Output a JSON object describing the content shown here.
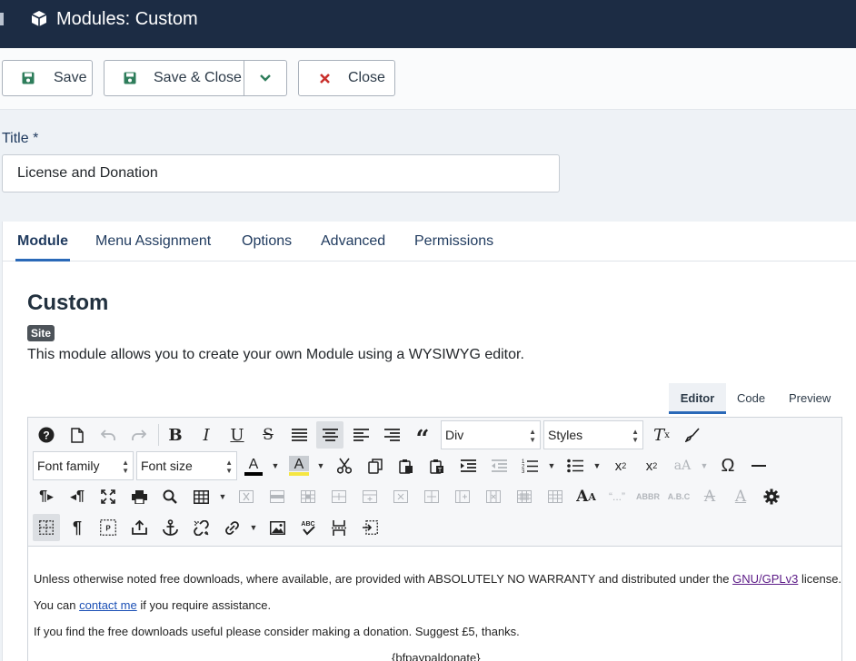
{
  "header": {
    "title": "Modules: Custom",
    "icon": "cube-icon"
  },
  "toolbar": {
    "save": "Save",
    "save_close": "Save & Close",
    "close": "Close"
  },
  "form": {
    "title_label": "Title *",
    "title_value": "License and Donation"
  },
  "tabs": [
    {
      "label": "Module",
      "active": true
    },
    {
      "label": "Menu Assignment"
    },
    {
      "label": "Options"
    },
    {
      "label": "Advanced"
    },
    {
      "label": "Permissions"
    }
  ],
  "module": {
    "title": "Custom",
    "badge": "Site",
    "description": "This module allows you to create your own Module using a WYSIWYG editor."
  },
  "editor_tabs": [
    {
      "label": "Editor",
      "active": true
    },
    {
      "label": "Code"
    },
    {
      "label": "Preview"
    }
  ],
  "editor_toolbar": {
    "block_format": "Div",
    "styles": "Styles",
    "font_family": "Font family",
    "font_size": "Font size",
    "text_color": "#000000",
    "highlight_color": "#f5e642"
  },
  "content": {
    "p1_before": "Unless otherwise noted free downloads, where available, are provided with ABSOLUTELY NO WARRANTY and distributed under the ",
    "p1_link": "GNU/GPLv3",
    "p1_after": " license.",
    "p2_before": "You can ",
    "p2_link": "contact me",
    "p2_after": " if you require assistance.",
    "p3": "If you find the free downloads useful please consider making a donation. Suggest £5, thanks.",
    "p4": "{bfpaypaldonate}"
  },
  "colors": {
    "header_bg": "#1c2c44",
    "accent": "#2a69b8",
    "save_icon": "#2e7d5b",
    "close_icon": "#c9302c"
  }
}
